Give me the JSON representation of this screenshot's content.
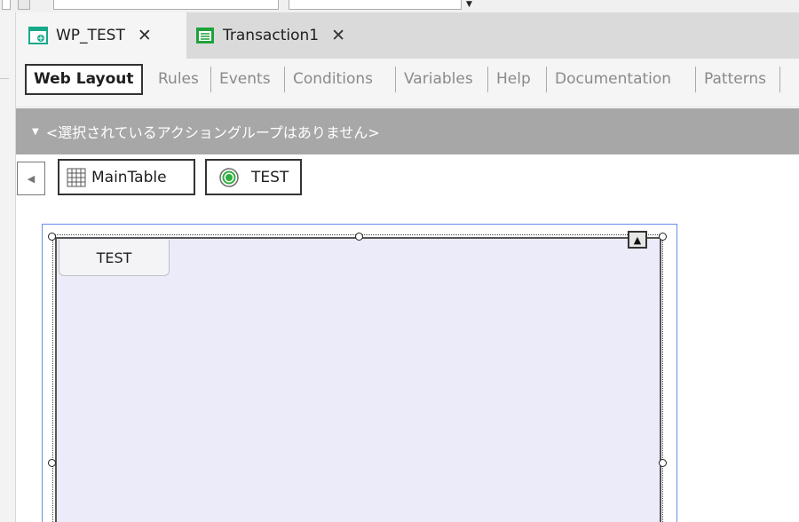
{
  "document_tabs": [
    {
      "label": "WP_TEST",
      "icon": "webpanel-icon",
      "close": "✕",
      "active": true
    },
    {
      "label": "Transaction1",
      "icon": "transaction-icon",
      "close": "✕",
      "active": false
    }
  ],
  "editor_tabs": [
    {
      "label": "Web Layout",
      "active": true
    },
    {
      "label": "Rules",
      "active": false
    },
    {
      "label": "Events",
      "active": false
    },
    {
      "label": "Conditions",
      "active": false
    },
    {
      "label": "Variables",
      "active": false
    },
    {
      "label": "Help",
      "active": false
    },
    {
      "label": "Documentation",
      "active": false
    },
    {
      "label": "Patterns",
      "active": false
    }
  ],
  "action_group": {
    "caret": "▼",
    "text": "<選択されているアクショングループはありません>"
  },
  "breadcrumb": {
    "back_glyph": "◀",
    "items": [
      {
        "label": "MainTable",
        "icon": "table-grid-icon"
      },
      {
        "label": "TEST",
        "icon": "radio-target-icon"
      }
    ]
  },
  "canvas": {
    "tab_label": "TEST",
    "collapse_glyph": "▲",
    "background": "#ebebfa",
    "selection_color": "#6a8ee6"
  },
  "colors": {
    "action_bar": "#a7a7a7",
    "tab_inactive": "#dadada",
    "tab_active": "#f5f5f5",
    "webpanel_icon": "#18a88a",
    "transaction_icon": "#1fa23a"
  }
}
